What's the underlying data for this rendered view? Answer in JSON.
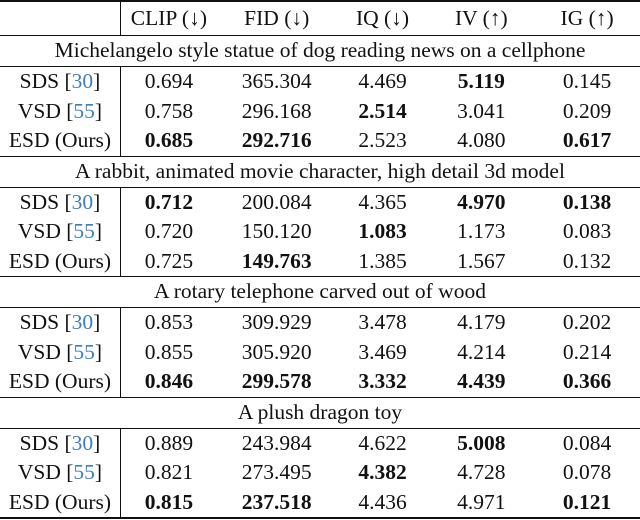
{
  "table": {
    "header": {
      "corner": "",
      "columns": [
        "CLIP (↓)",
        "FID (↓)",
        "IQ (↓)",
        "IV (↑)",
        "IG (↑)"
      ]
    },
    "groups": [
      {
        "prompt": "Michelangelo style statue of dog reading news on a cellphone",
        "rows": [
          {
            "method": "SDS",
            "cite": "30",
            "values": [
              "0.694",
              "365.304",
              "4.469",
              "5.119",
              "0.145"
            ],
            "bold": [
              false,
              false,
              false,
              true,
              false
            ]
          },
          {
            "method": "VSD",
            "cite": "55",
            "values": [
              "0.758",
              "296.168",
              "2.514",
              "3.041",
              "0.209"
            ],
            "bold": [
              false,
              false,
              true,
              false,
              false
            ]
          },
          {
            "method": "ESD (Ours)",
            "cite": "",
            "values": [
              "0.685",
              "292.716",
              "2.523",
              "4.080",
              "0.617"
            ],
            "bold": [
              true,
              true,
              false,
              false,
              true
            ]
          }
        ]
      },
      {
        "prompt": "A rabbit, animated movie character, high detail 3d model",
        "rows": [
          {
            "method": "SDS",
            "cite": "30",
            "values": [
              "0.712",
              "200.084",
              "4.365",
              "4.970",
              "0.138"
            ],
            "bold": [
              true,
              false,
              false,
              true,
              true
            ]
          },
          {
            "method": "VSD",
            "cite": "55",
            "values": [
              "0.720",
              "150.120",
              "1.083",
              "1.173",
              "0.083"
            ],
            "bold": [
              false,
              false,
              true,
              false,
              false
            ]
          },
          {
            "method": "ESD (Ours)",
            "cite": "",
            "values": [
              "0.725",
              "149.763",
              "1.385",
              "1.567",
              "0.132"
            ],
            "bold": [
              false,
              true,
              false,
              false,
              false
            ]
          }
        ]
      },
      {
        "prompt": "A rotary telephone carved out of wood",
        "rows": [
          {
            "method": "SDS",
            "cite": "30",
            "values": [
              "0.853",
              "309.929",
              "3.478",
              "4.179",
              "0.202"
            ],
            "bold": [
              false,
              false,
              false,
              false,
              false
            ]
          },
          {
            "method": "VSD",
            "cite": "55",
            "values": [
              "0.855",
              "305.920",
              "3.469",
              "4.214",
              "0.214"
            ],
            "bold": [
              false,
              false,
              false,
              false,
              false
            ]
          },
          {
            "method": "ESD (Ours)",
            "cite": "",
            "values": [
              "0.846",
              "299.578",
              "3.332",
              "4.439",
              "0.366"
            ],
            "bold": [
              true,
              true,
              true,
              true,
              true
            ]
          }
        ]
      },
      {
        "prompt": "A plush dragon toy",
        "rows": [
          {
            "method": "SDS",
            "cite": "30",
            "values": [
              "0.889",
              "243.984",
              "4.622",
              "5.008",
              "0.084"
            ],
            "bold": [
              false,
              false,
              false,
              true,
              false
            ]
          },
          {
            "method": "VSD",
            "cite": "55",
            "values": [
              "0.821",
              "273.495",
              "4.382",
              "4.728",
              "0.078"
            ],
            "bold": [
              false,
              false,
              true,
              false,
              false
            ]
          },
          {
            "method": "ESD (Ours)",
            "cite": "",
            "values": [
              "0.815",
              "237.518",
              "4.436",
              "4.971",
              "0.121"
            ],
            "bold": [
              true,
              true,
              false,
              false,
              true
            ]
          }
        ]
      }
    ],
    "colors": {
      "citation": "#3a7fc1",
      "text": "#111111"
    }
  }
}
